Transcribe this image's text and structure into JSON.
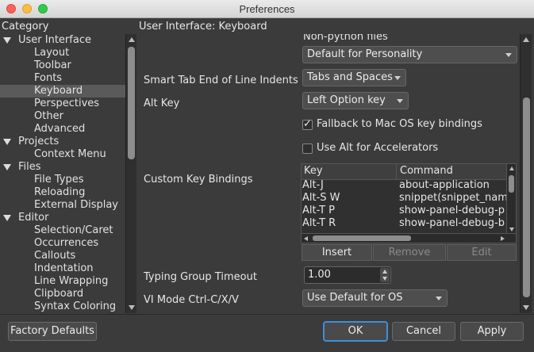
{
  "window": {
    "title": "Preferences"
  },
  "headers": {
    "category": "Category",
    "section": "User Interface: Keyboard"
  },
  "tree": [
    {
      "label": "User Interface",
      "level": 0,
      "expanded": true
    },
    {
      "label": "Layout",
      "level": 1
    },
    {
      "label": "Toolbar",
      "level": 1
    },
    {
      "label": "Fonts",
      "level": 1
    },
    {
      "label": "Keyboard",
      "level": 1,
      "selected": true
    },
    {
      "label": "Perspectives",
      "level": 1
    },
    {
      "label": "Other",
      "level": 1
    },
    {
      "label": "Advanced",
      "level": 1
    },
    {
      "label": "Projects",
      "level": 0,
      "expanded": true
    },
    {
      "label": "Context Menu",
      "level": 1
    },
    {
      "label": "Files",
      "level": 0,
      "expanded": true
    },
    {
      "label": "File Types",
      "level": 1
    },
    {
      "label": "Reloading",
      "level": 1
    },
    {
      "label": "External Display",
      "level": 1
    },
    {
      "label": "Editor",
      "level": 0,
      "expanded": true
    },
    {
      "label": "Selection/Caret",
      "level": 1
    },
    {
      "label": "Occurrences",
      "level": 1
    },
    {
      "label": "Callouts",
      "level": 1
    },
    {
      "label": "Indentation",
      "level": 1
    },
    {
      "label": "Line Wrapping",
      "level": 1
    },
    {
      "label": "Clipboard",
      "level": 1
    },
    {
      "label": "Syntax Coloring",
      "level": 1
    }
  ],
  "settings": {
    "non_python_label": "Non-python files",
    "non_python_value": "Default for Personality",
    "smart_tab_label": "Smart Tab End of Line Indents",
    "smart_tab_value": "Tabs and Spaces",
    "alt_key_label": "Alt Key",
    "alt_key_value": "Left Option key",
    "fallback_label": "Fallback to Mac OS key bindings",
    "fallback_checked": true,
    "use_alt_label": "Use Alt for Accelerators",
    "use_alt_checked": false,
    "custom_bindings_label": "Custom Key Bindings",
    "typing_group_label": "Typing Group Timeout",
    "typing_group_value": "1.00",
    "vi_mode_label": "VI Mode Ctrl-C/X/V",
    "vi_mode_value": "Use Default for OS"
  },
  "key_bindings": {
    "columns": [
      "Key",
      "Command"
    ],
    "rows": [
      {
        "key": "Alt-J",
        "command": "about-application"
      },
      {
        "key": "Alt-S W",
        "command": "snippet(snippet_name"
      },
      {
        "key": "Alt-T P",
        "command": "show-panel-debug-p"
      },
      {
        "key": "Alt-T R",
        "command": "show-panel-debug-b"
      }
    ],
    "buttons": {
      "insert": "Insert",
      "remove": "Remove",
      "edit": "Edit"
    }
  },
  "footer": {
    "factory_defaults": "Factory Defaults",
    "ok": "OK",
    "cancel": "Cancel",
    "apply": "Apply"
  },
  "colors": {
    "background": "#3b3b3b",
    "selection": "#5a5a5a",
    "default_button_ring": "#3e8ede"
  }
}
